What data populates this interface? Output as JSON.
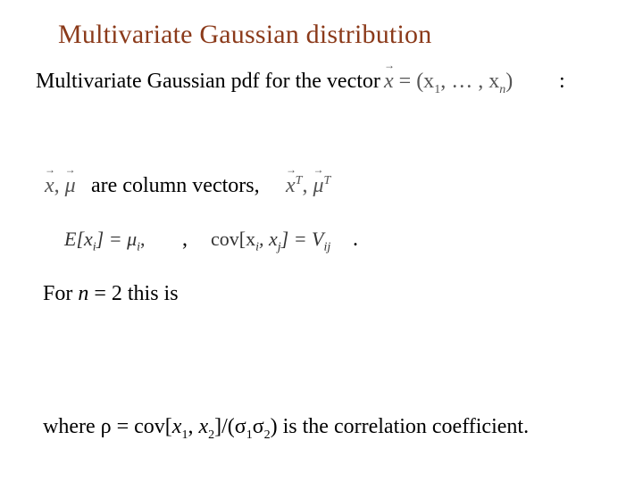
{
  "title": "Multivariate Gaussian distribution",
  "line1": "Multivariate Gaussian pdf for the vector",
  "vec_def_a": "x",
  "vec_def_b": " = (x",
  "vec_def_c": "1",
  "vec_def_d": ", … , x",
  "vec_def_e": "n",
  "vec_def_f": ")",
  "colon": ":",
  "vectors_left_x": "x",
  "vectors_left_sep": ", ",
  "vectors_left_mu": "μ",
  "line2_text": "are column vectors,",
  "vectors_right_x": "x",
  "vectors_right_T1": "T",
  "vectors_right_sep": ", ",
  "vectors_right_mu": "μ",
  "vectors_right_T2": "T",
  "eq1_a": "E[x",
  "eq1_b": "i",
  "eq1_c": "] = μ",
  "eq1_d": "i",
  "eq1_e": ",",
  "comma": ",",
  "eq2_a": "cov[x",
  "eq2_b": "i",
  "eq2_c": ", x",
  "eq2_d": "j",
  "eq2_e": "] = V",
  "eq2_f": "ij",
  "period": ".",
  "line4_a": "For ",
  "line4_b": "n",
  "line4_c": " = 2 this is",
  "line5_a": "where ρ = cov[",
  "line5_b": "x",
  "line5_c": "1",
  "line5_d": ", ",
  "line5_e": "x",
  "line5_f": "2",
  "line5_g": "]/(σ",
  "line5_h": "1",
  "line5_i": "σ",
  "line5_j": "2",
  "line5_k": ") is the correlation coefficient."
}
